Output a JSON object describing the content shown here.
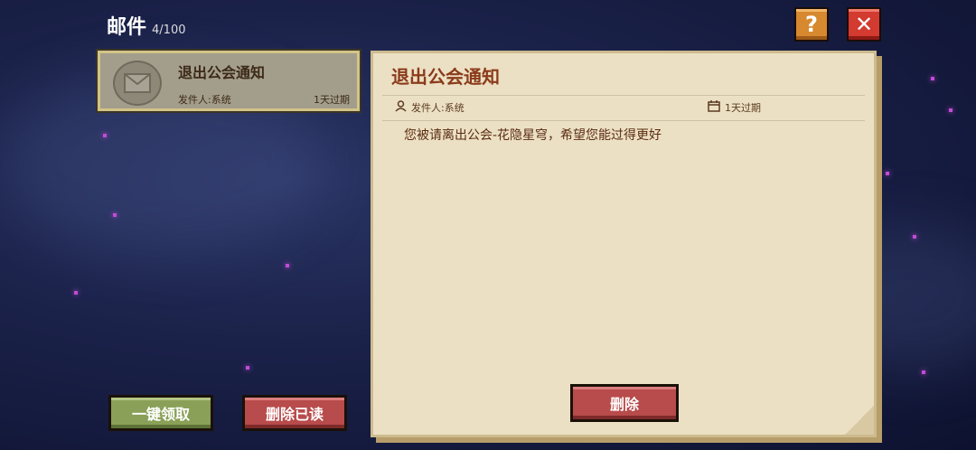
{
  "header": {
    "title": "邮件",
    "count": "4/100"
  },
  "mail_list": [
    {
      "title": "退出公会通知",
      "sender": "发件人:系统",
      "expire": "1天过期"
    }
  ],
  "detail": {
    "title": "退出公会通知",
    "sender": "发件人:系统",
    "expire": "1天过期",
    "body": "您被请离出公会-花隐星穹，希望您能过得更好",
    "delete_label": "删除"
  },
  "bottom": {
    "claim_all": "一键领取",
    "delete_read": "删除已读"
  },
  "icons": {
    "help": "help-icon",
    "close": "close-icon"
  },
  "colors": {
    "accent_red": "#d33a30",
    "accent_orange": "#d7892f",
    "accent_green": "#8aa058"
  }
}
